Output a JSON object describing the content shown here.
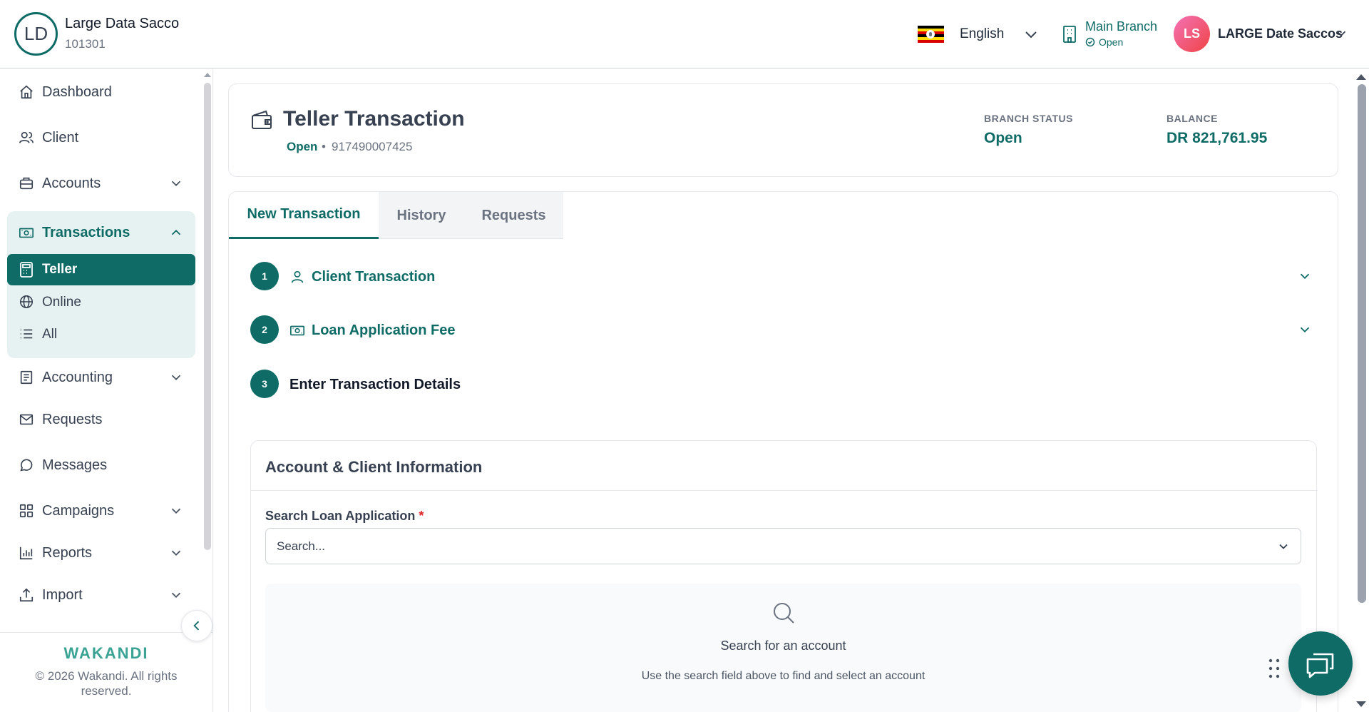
{
  "header": {
    "org_initials": "LD",
    "org_name": "Large Data Sacco",
    "org_code": "101301",
    "language": "English",
    "branch_name": "Main Branch",
    "branch_status": "Open",
    "user_initials": "LS",
    "user_name": "LARGE Date Saccos"
  },
  "sidebar": {
    "items": [
      {
        "label": "Dashboard",
        "icon": "home-icon"
      },
      {
        "label": "Client",
        "icon": "users-icon"
      },
      {
        "label": "Accounts",
        "icon": "briefcase-icon"
      },
      {
        "label": "Transactions",
        "icon": "banknote-icon"
      },
      {
        "label": "Accounting",
        "icon": "ledger-icon"
      },
      {
        "label": "Requests",
        "icon": "mail-icon"
      },
      {
        "label": "Messages",
        "icon": "chat-bubble-icon"
      },
      {
        "label": "Campaigns",
        "icon": "grid-icon"
      },
      {
        "label": "Reports",
        "icon": "bar-chart-icon"
      },
      {
        "label": "Import",
        "icon": "upload-icon"
      }
    ],
    "transactions_sub": [
      {
        "label": "Teller",
        "icon": "calculator-icon"
      },
      {
        "label": "Online",
        "icon": "globe-icon"
      },
      {
        "label": "All",
        "icon": "list-icon"
      }
    ],
    "brand": "WAKANDI",
    "copyright": "© 2026 Wakandi. All rights reserved."
  },
  "page": {
    "title": "Teller Transaction",
    "status": "Open",
    "separator": "•",
    "teller_number": "917490007425",
    "branch_status_label": "BRANCH STATUS",
    "branch_status_value": "Open",
    "balance_label": "BALANCE",
    "balance_value": "DR 821,761.95"
  },
  "tabs": [
    "New Transaction",
    "History",
    "Requests"
  ],
  "steps": [
    {
      "number": "1",
      "label": "Client Transaction",
      "icon": "user-icon"
    },
    {
      "number": "2",
      "label": "Loan Application Fee",
      "icon": "banknote-icon"
    },
    {
      "number": "3",
      "label": "Enter Transaction Details"
    }
  ],
  "account_info": {
    "title": "Account & Client Information",
    "field_label": "Search Loan Application",
    "required_mark": "*",
    "placeholder": "Search...",
    "empty_title": "Search for an account",
    "empty_desc": "Use the search field above to find and select an account"
  },
  "colors": {
    "primary": "#0f6b66",
    "active_bg": "#e6f2f1",
    "avatar_gradient": "#ef4444"
  }
}
